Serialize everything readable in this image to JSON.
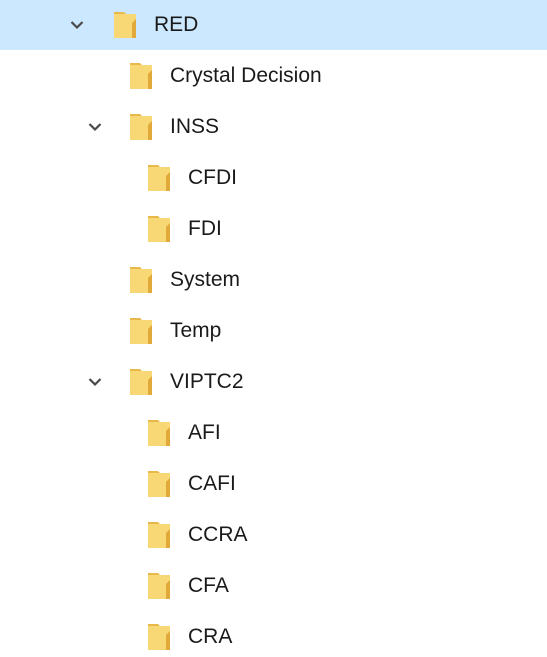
{
  "tree": {
    "items": [
      {
        "label": "RED",
        "level": 0,
        "expanded": true,
        "selected": true,
        "icon": "folder-icon"
      },
      {
        "label": "Crystal Decision",
        "level": 1,
        "expanded": null,
        "selected": false,
        "icon": "folder-icon"
      },
      {
        "label": "INSS",
        "level": 1,
        "expanded": true,
        "selected": false,
        "icon": "folder-icon"
      },
      {
        "label": "CFDI",
        "level": 2,
        "expanded": null,
        "selected": false,
        "icon": "folder-icon"
      },
      {
        "label": "FDI",
        "level": 2,
        "expanded": null,
        "selected": false,
        "icon": "folder-icon"
      },
      {
        "label": "System",
        "level": 1,
        "expanded": null,
        "selected": false,
        "icon": "folder-icon"
      },
      {
        "label": "Temp",
        "level": 1,
        "expanded": null,
        "selected": false,
        "icon": "folder-icon"
      },
      {
        "label": "VIPTC2",
        "level": 1,
        "expanded": true,
        "selected": false,
        "icon": "folder-icon"
      },
      {
        "label": "AFI",
        "level": 2,
        "expanded": null,
        "selected": false,
        "icon": "folder-icon"
      },
      {
        "label": "CAFI",
        "level": 2,
        "expanded": null,
        "selected": false,
        "icon": "folder-icon"
      },
      {
        "label": "CCRA",
        "level": 2,
        "expanded": null,
        "selected": false,
        "icon": "folder-icon"
      },
      {
        "label": "CFA",
        "level": 2,
        "expanded": null,
        "selected": false,
        "icon": "folder-icon"
      },
      {
        "label": "CRA",
        "level": 2,
        "expanded": null,
        "selected": false,
        "icon": "folder-icon"
      }
    ],
    "selection_color": "#cce8ff",
    "folder_color": "#f8d775"
  }
}
